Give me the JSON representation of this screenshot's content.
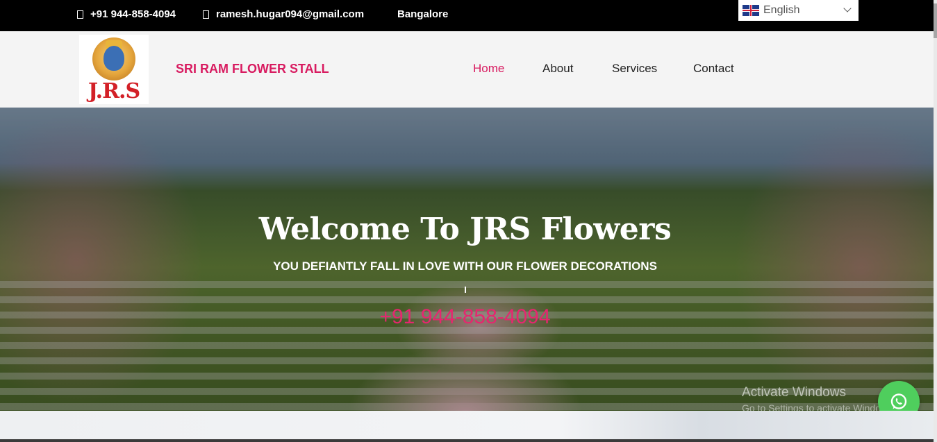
{
  "topbar": {
    "phone": "+91 944-858-4094",
    "email": "ramesh.hugar094@gmail.com",
    "location": "Bangalore",
    "language": "English"
  },
  "header": {
    "logo_text": "J.R.S",
    "brand": "SRI RAM FLOWER STALL",
    "nav": [
      "Home",
      "About",
      "Services",
      "Contact"
    ],
    "active_nav": "Home"
  },
  "hero": {
    "title": "Welcome To JRS Flowers",
    "subtitle": "YOU DEFIANTLY FALL IN LOVE WITH OUR FLOWER DECORATIONS",
    "phone": "+91 944-858-4094"
  },
  "watermark": {
    "title": "Activate Windows",
    "subtitle": "Go to Settings to activate Windows."
  },
  "colors": {
    "accent": "#d81b60",
    "phone_pink": "#e6266f",
    "whatsapp_green": "#4fce5d",
    "topbar_bg": "#000000"
  },
  "icons": [
    "phone-icon",
    "mail-icon",
    "uk-flag-icon",
    "chevron-down-icon",
    "whatsapp-icon"
  ]
}
